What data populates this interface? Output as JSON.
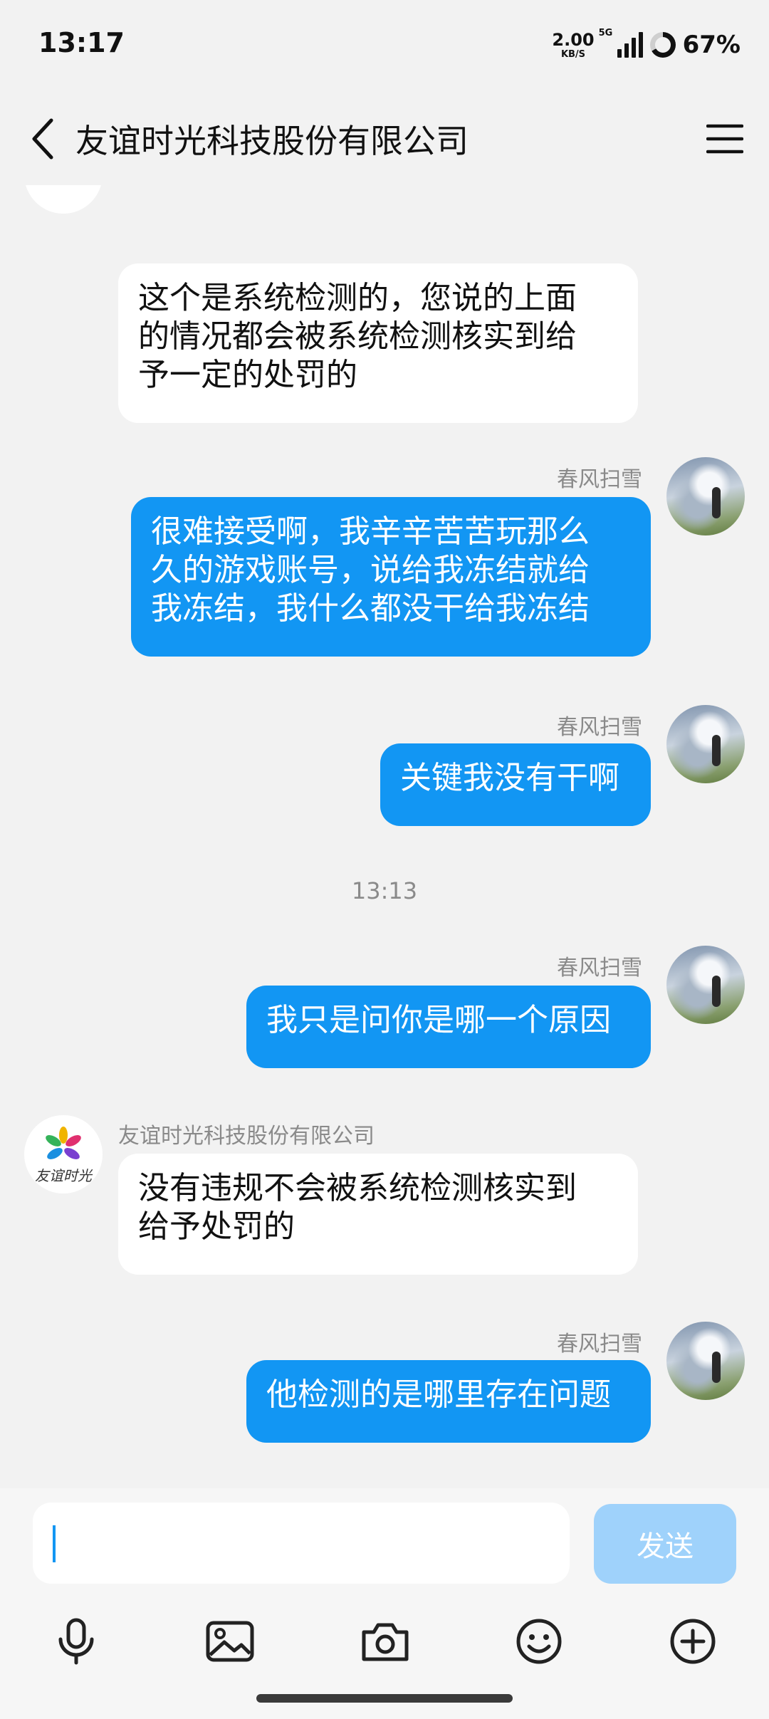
{
  "status": {
    "time": "13:17",
    "net_speed_value": "2.00",
    "net_speed_unit": "KB/S",
    "network_type": "5G",
    "battery": "67%"
  },
  "header": {
    "title": "友谊时光科技股份有限公司"
  },
  "chat": {
    "messages": [
      {
        "direction": "in",
        "lines": [
          "这个是系统检测的，您说的上面",
          "的情况都会被系统检测核实到给",
          "予一定的处罚的"
        ]
      },
      {
        "direction": "out",
        "sender": "春风扫雪",
        "lines": [
          "很难接受啊，我辛辛苦苦玩那么",
          "久的游戏账号，说给我冻结就给",
          "我冻结，我什么都没干给我冻结"
        ]
      },
      {
        "direction": "out",
        "sender": "春风扫雪",
        "lines": [
          "关键我没有干啊"
        ]
      },
      {
        "direction": "out",
        "sender": "春风扫雪",
        "lines": [
          "我只是问你是哪一个原因"
        ]
      },
      {
        "direction": "in",
        "sender": "友谊时光科技股份有限公司",
        "avatar_text": "友谊时光",
        "lines": [
          "没有违规不会被系统检测核实到",
          "给予处罚的"
        ]
      },
      {
        "direction": "out",
        "sender": "春风扫雪",
        "lines": [
          "他检测的是哪里存在问题"
        ]
      }
    ],
    "time_separator": "13:13"
  },
  "input": {
    "value": "",
    "placeholder": "",
    "send_label": "发送"
  },
  "toolbar": {
    "icons": [
      "microphone-icon",
      "image-icon",
      "camera-icon",
      "emoji-icon",
      "plus-icon"
    ]
  },
  "colors": {
    "outgoing_bubble": "#1296f3",
    "incoming_bubble": "#ffffff",
    "send_button_disabled": "#9fd2fb",
    "background": "#f2f2f2"
  }
}
